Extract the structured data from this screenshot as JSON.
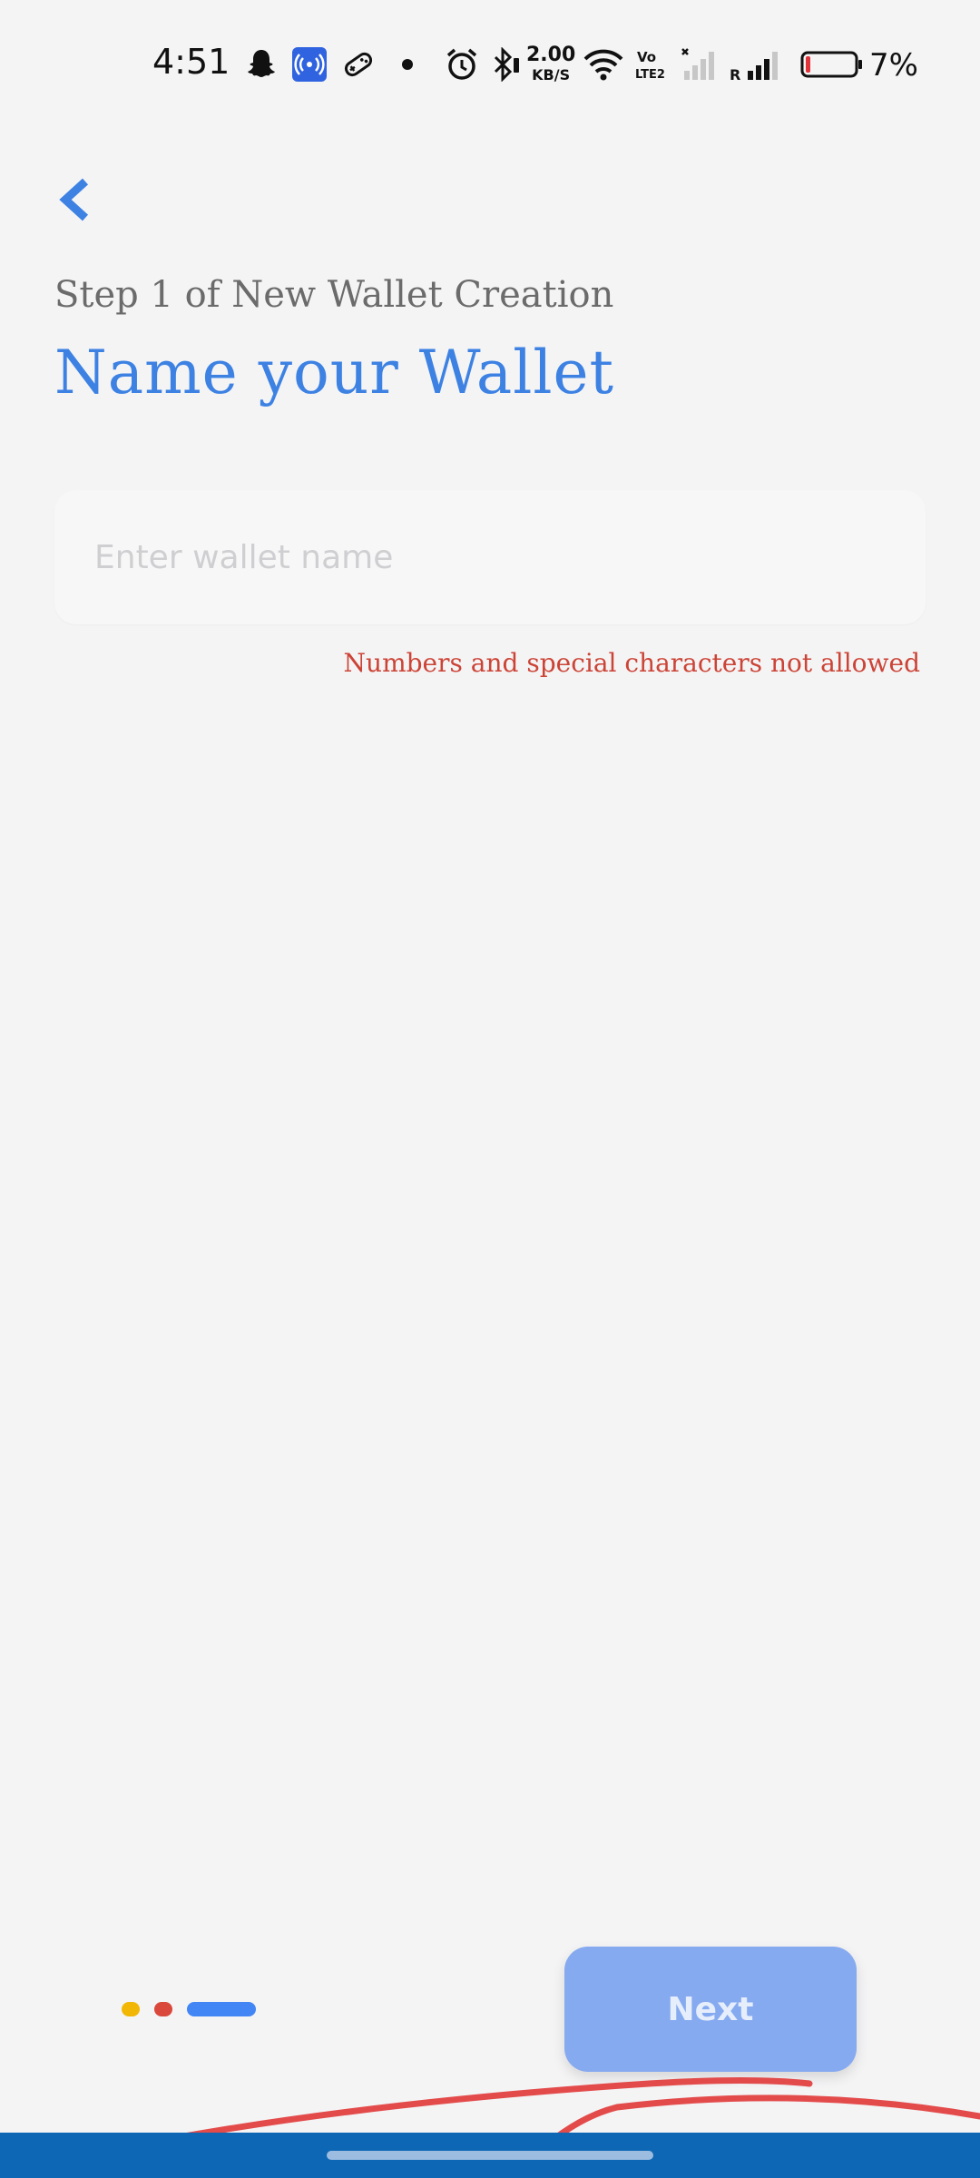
{
  "status_bar": {
    "time": "4:51",
    "net_speed_value": "2.00",
    "net_speed_unit": "KB/S",
    "battery_percent": "7%",
    "icons": [
      "snapchat-icon",
      "hotspot-icon",
      "game-icon",
      "notification-dot-icon",
      "alarm-icon",
      "bluetooth-icon",
      "wifi-icon",
      "volte-icon",
      "signal-icon",
      "signal-roaming-icon",
      "battery-icon"
    ]
  },
  "header": {
    "back_icon": "chevron-left-icon",
    "step_label": "Step 1 of New Wallet Creation",
    "title": "Name your Wallet"
  },
  "form": {
    "wallet_name_value": "",
    "wallet_name_placeholder": "Enter wallet name",
    "error_message": "Numbers and special characters not allowed"
  },
  "progress": {
    "current_step": 3,
    "total_steps": 3,
    "colors": [
      "#f2b705",
      "#d9483b",
      "#4285f4"
    ]
  },
  "footer": {
    "next_label": "Next"
  },
  "colors": {
    "accent": "#3d82e3",
    "error": "#cc4436",
    "next_button": "#86aaf0",
    "nav_bar": "#0d67b5",
    "annotation_stroke": "#e34b4b"
  }
}
